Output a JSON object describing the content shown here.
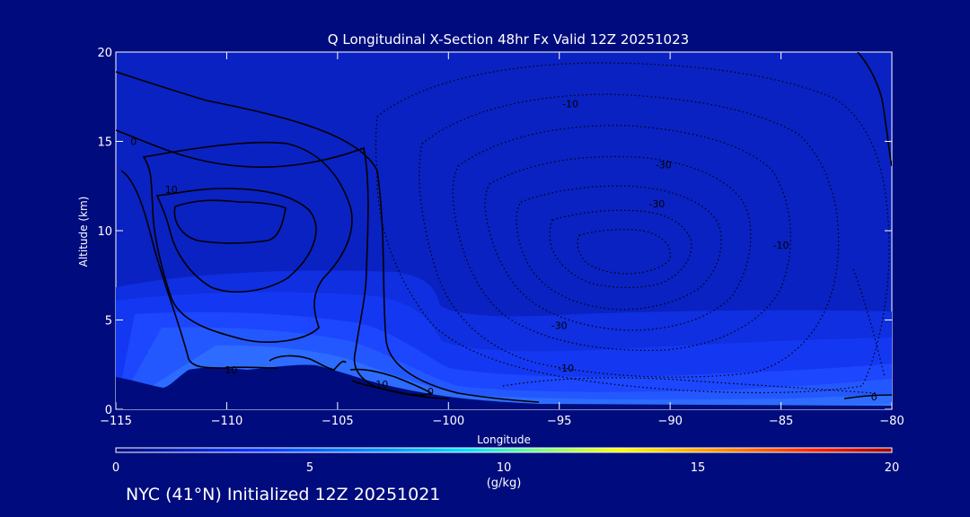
{
  "chart_data": {
    "type": "heatmap",
    "title": "Q Longitudinal X-Section 48hr  Fx Valid 12Z 20251023",
    "xlabel": "Longitude",
    "ylabel": "Altitude (km)",
    "xlim": [
      -115,
      -80
    ],
    "ylim": [
      0,
      20
    ],
    "xticks": [
      -115,
      -110,
      -105,
      -100,
      -95,
      -90,
      -85,
      -80
    ],
    "xtick_labels": [
      "−115",
      "−110",
      "−105",
      "−100",
      "−95",
      "−90",
      "−85",
      "−80"
    ],
    "yticks": [
      0,
      5,
      10,
      15,
      20
    ],
    "ytick_labels": [
      "0",
      "5",
      "10",
      "15",
      "20"
    ],
    "grid": false,
    "colorbar": {
      "label": "(g/kg)",
      "range": [
        0,
        20
      ],
      "ticks": [
        0,
        5,
        10,
        15,
        20
      ],
      "tick_labels": [
        "0",
        "5",
        "10",
        "15",
        "20"
      ]
    },
    "contour_labels": [
      {
        "text": "0",
        "x": -114.2,
        "y": 14.8
      },
      {
        "text": "10",
        "x": -112.5,
        "y": 12.1
      },
      {
        "text": "10",
        "x": -109.8,
        "y": 2.0
      },
      {
        "text": "10",
        "x": -103,
        "y": 1.2
      },
      {
        "text": "0",
        "x": -100.8,
        "y": 0.8
      },
      {
        "text": "-10",
        "x": -94.5,
        "y": 16.9
      },
      {
        "text": "-30",
        "x": -90.3,
        "y": 13.5
      },
      {
        "text": "-30",
        "x": -90.6,
        "y": 11.3
      },
      {
        "text": "-30",
        "x": -95,
        "y": 4.5
      },
      {
        "text": "-10",
        "x": -94.7,
        "y": 2.1
      },
      {
        "text": "-10",
        "x": -85,
        "y": 9.0
      },
      {
        "text": "0",
        "x": -80.8,
        "y": 0.5
      }
    ]
  },
  "footer": {
    "text": "NYC (41°N) Initialized 12Z 20251021"
  }
}
